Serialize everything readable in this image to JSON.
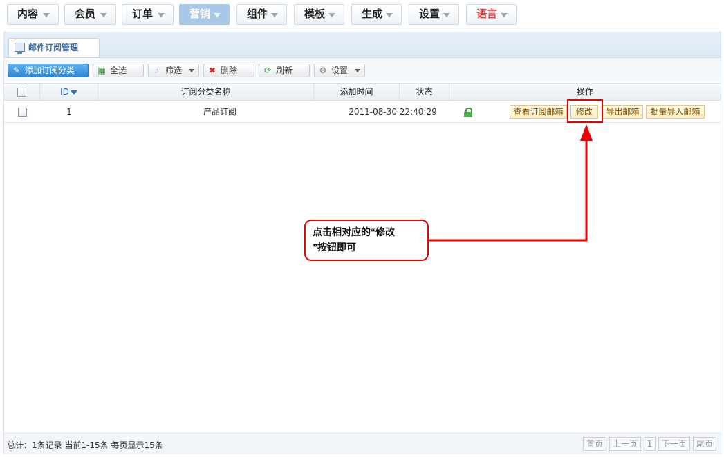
{
  "nav": {
    "items": [
      {
        "label": "内容"
      },
      {
        "label": "会员"
      },
      {
        "label": "订单"
      },
      {
        "label": "营销"
      },
      {
        "label": "组件"
      },
      {
        "label": "模板"
      },
      {
        "label": "生成"
      },
      {
        "label": "设置"
      },
      {
        "label": "语言"
      }
    ],
    "active": "营销",
    "active_color": "#a9c7e6",
    "language_color": "#e33333"
  },
  "panel": {
    "tab_title": "邮件订阅管理"
  },
  "toolbar": {
    "add_label": "添加订阅分类",
    "select_all_label": "全选",
    "filter_label": "筛选",
    "delete_label": "删除",
    "refresh_label": "刷新",
    "settings_label": "设置"
  },
  "table": {
    "headers": {
      "id": "ID",
      "name": "订阅分类名称",
      "time": "添加时间",
      "status": "状态",
      "actions": "操作"
    },
    "rows": [
      {
        "id": "1",
        "name": "产品订阅",
        "time": "2011-08-30 22:40:29",
        "status_icon": "unlocked-icon",
        "actions": [
          "查看订阅邮箱",
          "修改",
          "导出邮箱",
          "批量导入邮箱"
        ]
      }
    ]
  },
  "footer": {
    "summary": "总计：1条记录 当前1-15条 每页显示15条",
    "first": "首页",
    "prev": "上一页",
    "page": "1",
    "next": "下一页",
    "last": "尾页"
  },
  "annotation": {
    "text_line1": "点击相对应的“修改",
    "text_line2": "”按钮即可",
    "color": "#ee0000"
  }
}
